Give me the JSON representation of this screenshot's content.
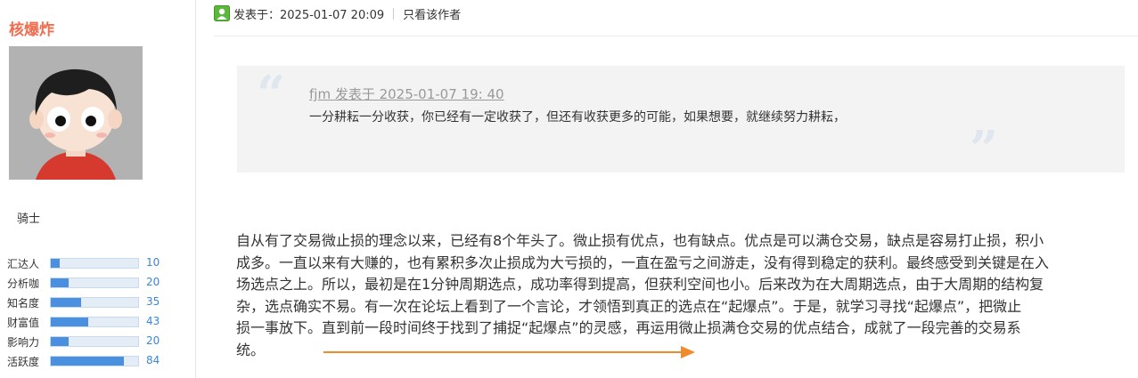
{
  "user": {
    "name": "核爆炸",
    "rank": "骑士",
    "stats": [
      {
        "label": "汇达人",
        "value": "10",
        "level": 0.1
      },
      {
        "label": "分析咖",
        "value": "20",
        "level": 0.2
      },
      {
        "label": "知名度",
        "value": "35",
        "level": 0.35
      },
      {
        "label": "财富值",
        "value": "43",
        "level": 0.43
      },
      {
        "label": "影响力",
        "value": "20",
        "level": 0.2
      },
      {
        "label": "活跃度",
        "value": "84",
        "level": 0.84
      }
    ]
  },
  "post": {
    "posted_at": "发表于：2025-01-07 20:09",
    "author_only": "只看该作者",
    "quote": {
      "meta": "fjm 发表于 2025-01-07 19: 40",
      "text": "一分耕耘一分收获，你已经有一定收获了，但还有收获更多的可能，如果想要，就继续努力耕耘，"
    },
    "body_lines": [
      "自从有了交易微止损的理念以来，已经有8个年头了。微止损有优点，也有缺点。优点是可以满仓交易，缺点是容易打止损，积小",
      "成多。一直以来有大赚的，也有累积多次止损成为大亏损的，一直在盈亏之间游走，没有得到稳定的获利。最终感受到关键是在入",
      "场选点之上。所以，最初是在1分钟周期选点，成功率得到提高，但获利空间也小。后来改为在大周期选点，由于大周期的结构复",
      "杂，选点确实不易。有一次在论坛上看到了一个言论，才领悟到真正的选点在“起爆点”。于是，就学习寻找“起爆点”，把微止",
      "损一事放下。直到前一段时间终于找到了捕捉“起爆点”的灵感，再运用微止损满仓交易的优点结合，成就了一段完善的交易系",
      "统。"
    ]
  },
  "colors": {
    "username": "#f26c4f",
    "stat_fill": "#4a8fe0",
    "stat_value": "#3a86d8",
    "arrow": "#f08a2c"
  }
}
